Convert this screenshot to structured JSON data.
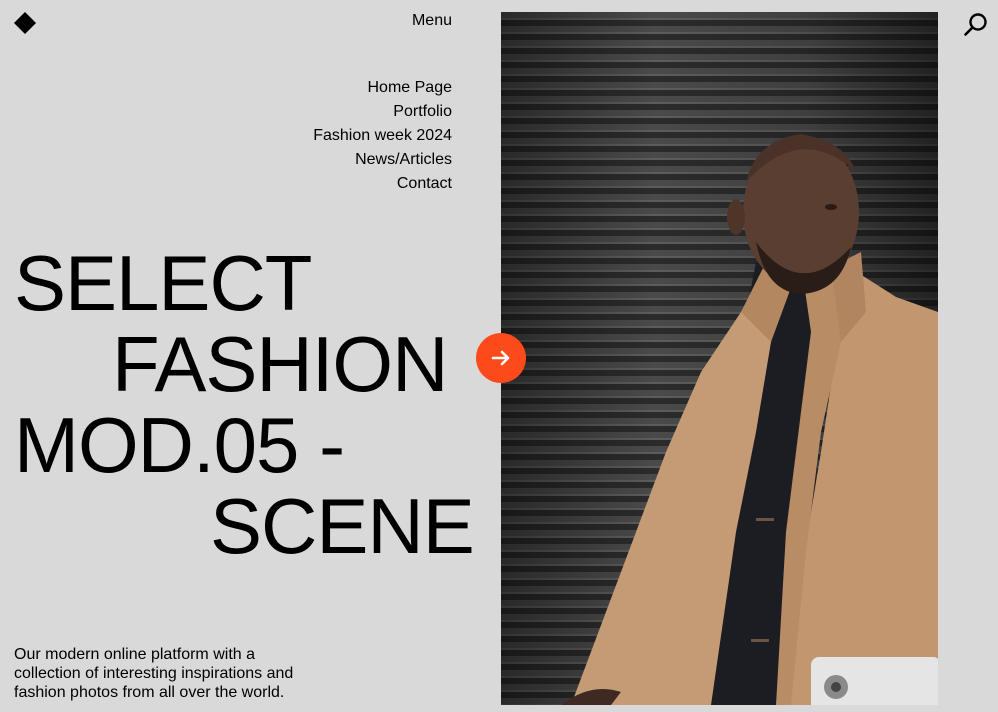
{
  "header": {
    "menu_label": "Menu"
  },
  "nav": {
    "items": [
      "Home Page",
      "Portfolio",
      "Fashion week 2024",
      "News/Articles",
      "Contact"
    ]
  },
  "hero": {
    "headline_lines": [
      "SELECT",
      "FASHION",
      "MOD.05 -",
      "SCENE"
    ],
    "description": "Our modern online platform with a collection of interesting inspirations and fashion photos from all over the world."
  },
  "icons": {
    "logo": "diamond-logo-icon",
    "search": "search-icon",
    "cta": "arrow-right-icon"
  },
  "colors": {
    "background": "#d9d9d9",
    "accent": "#fc4a1a",
    "text": "#000000",
    "coat": "#c49b74"
  }
}
